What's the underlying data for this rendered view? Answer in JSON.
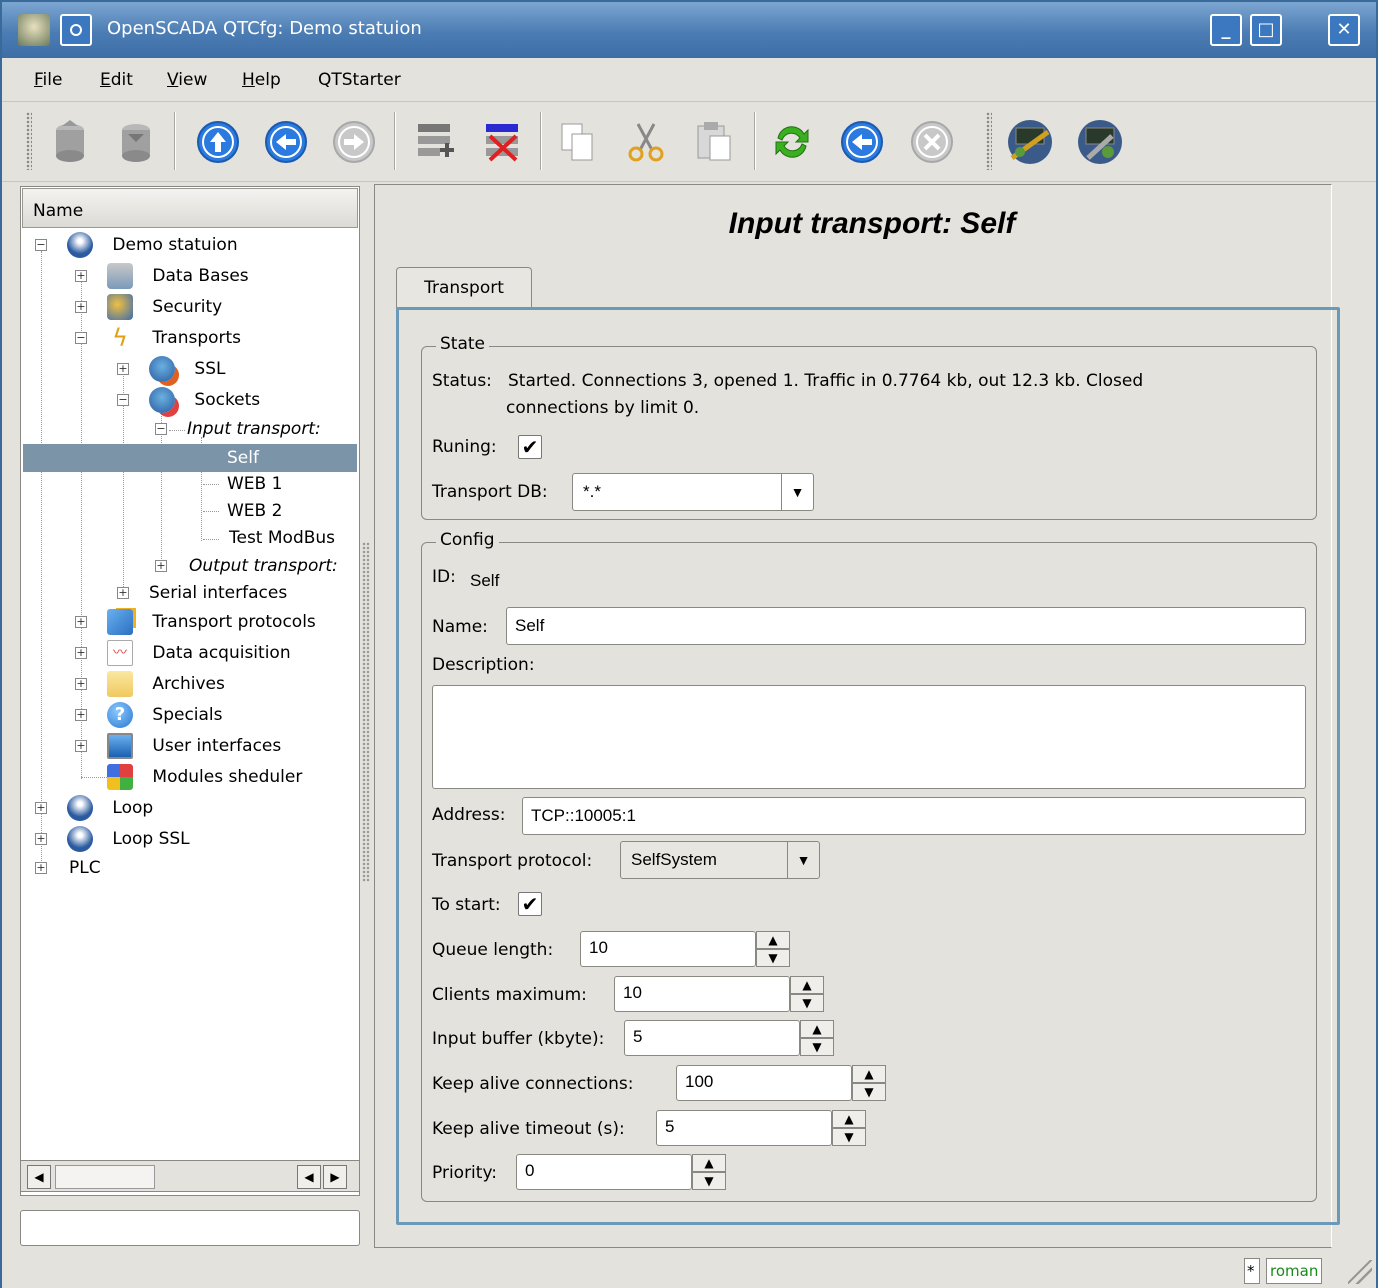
{
  "window": {
    "title": "OpenSCADA QTCfg: Demo statuion",
    "controls": [
      "minimize-icon",
      "maximize-icon",
      "close-icon"
    ]
  },
  "menu": {
    "items": [
      {
        "label": "File",
        "accel": "F"
      },
      {
        "label": "Edit",
        "accel": "E"
      },
      {
        "label": "View",
        "accel": "V"
      },
      {
        "label": "Help",
        "accel": "H"
      },
      {
        "label": "QTStarter",
        "accel": ""
      }
    ]
  },
  "toolbar": {
    "tools": [
      "db-load-icon",
      "db-save-icon",
      "up-icon",
      "back-icon",
      "forward-icon",
      "add-item-icon",
      "delete-item-icon",
      "copy-icon",
      "cut-icon",
      "paste-icon",
      "refresh-icon",
      "start-icon",
      "stop-icon",
      "qtcfg-icon",
      "uivision-icon"
    ]
  },
  "tree": {
    "header": "Name",
    "items": [
      {
        "label": "Demo statuion",
        "level": 0,
        "icon": "station-icon",
        "expanded": true
      },
      {
        "label": "Data Bases",
        "level": 1,
        "icon": "database-icon",
        "expanded": false
      },
      {
        "label": "Security",
        "level": 1,
        "icon": "security-icon",
        "expanded": false
      },
      {
        "label": "Transports",
        "level": 1,
        "icon": "lightning-icon",
        "expanded": true
      },
      {
        "label": "SSL",
        "level": 2,
        "icon": "ssl-icon",
        "expanded": false
      },
      {
        "label": "Sockets",
        "level": 2,
        "icon": "sockets-icon",
        "expanded": true
      },
      {
        "label": "Input transport:",
        "level": 3,
        "icon": "",
        "expanded": true,
        "italic": true
      },
      {
        "label": "Self",
        "level": 4,
        "icon": "",
        "selected": true
      },
      {
        "label": "WEB 1",
        "level": 4,
        "icon": ""
      },
      {
        "label": "WEB 2",
        "level": 4,
        "icon": ""
      },
      {
        "label": "Test ModBus",
        "level": 4,
        "icon": ""
      },
      {
        "label": "Output transport:",
        "level": 3,
        "icon": "",
        "expanded": false,
        "italic": true
      },
      {
        "label": "Serial interfaces",
        "level": 2,
        "icon": "",
        "expanded": false
      },
      {
        "label": "Transport protocols",
        "level": 1,
        "icon": "folder-icon",
        "expanded": false
      },
      {
        "label": "Data acquisition",
        "level": 1,
        "icon": "chart-icon",
        "expanded": false
      },
      {
        "label": "Archives",
        "level": 1,
        "icon": "archive-icon",
        "expanded": false
      },
      {
        "label": "Specials",
        "level": 1,
        "icon": "help-icon",
        "expanded": false
      },
      {
        "label": "User interfaces",
        "level": 1,
        "icon": "monitor-icon",
        "expanded": false
      },
      {
        "label": "Modules sheduler",
        "level": 1,
        "icon": "modules-icon"
      },
      {
        "label": "Loop",
        "level": 0,
        "icon": "station-icon",
        "expanded": false
      },
      {
        "label": "Loop SSL",
        "level": 0,
        "icon": "station-icon",
        "expanded": false
      },
      {
        "label": "PLC",
        "level": 0,
        "icon": "",
        "expanded": false
      }
    ]
  },
  "page": {
    "title": "Input transport: Self",
    "tab": "Transport",
    "state": {
      "group_title": "State",
      "status_label": "Status:",
      "status_line1": "Started. Connections 3, opened 1. Traffic in 0.7764 kb, out 12.3 kb. Closed",
      "status_line2": "connections by limit 0.",
      "running_label": "Runing:",
      "running_checked": true,
      "db_label": "Transport DB:",
      "db_value": "*.*"
    },
    "config": {
      "group_title": "Config",
      "id_label": "ID:",
      "id_value": "Self",
      "name_label": "Name:",
      "name_value": "Self",
      "description_label": "Description:",
      "description_value": "",
      "address_label": "Address:",
      "address_value": "TCP::10005:1",
      "protocol_label": "Transport protocol:",
      "protocol_value": "SelfSystem",
      "to_start_label": "To start:",
      "to_start_checked": true,
      "queue_label": "Queue length:",
      "queue_value": "10",
      "clients_label": "Clients maximum:",
      "clients_value": "10",
      "buffer_label": "Input buffer (kbyte):",
      "buffer_value": "5",
      "keepalive_conn_label": "Keep alive connections:",
      "keepalive_conn_value": "100",
      "keepalive_timeout_label": "Keep alive timeout (s):",
      "keepalive_timeout_value": "5",
      "priority_label": "Priority:",
      "priority_value": "0"
    }
  },
  "statusbar": {
    "indicator": "*",
    "user": "roman"
  },
  "colors": {
    "titlebar": "#4b7cb3",
    "selection": "#7c94a8",
    "tab_frame": "#6a9ab8",
    "user_text": "#1a8a1a"
  }
}
